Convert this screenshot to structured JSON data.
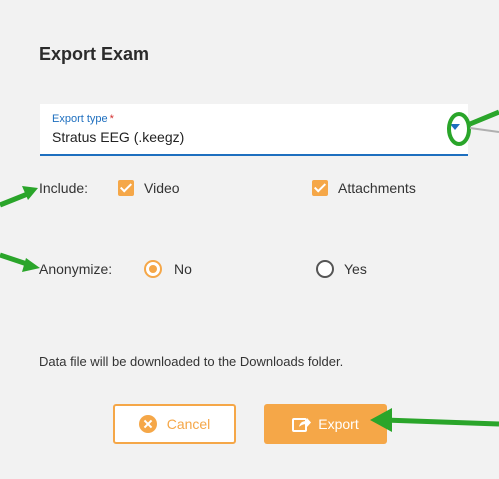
{
  "dialog": {
    "title": "Export Exam",
    "export_type": {
      "label": "Export type",
      "required_mark": "*",
      "value": "Stratus EEG (.keegz)"
    },
    "include": {
      "label": "Include:",
      "options": [
        {
          "label": "Video",
          "checked": true
        },
        {
          "label": "Attachments",
          "checked": true
        }
      ]
    },
    "anonymize": {
      "label": "Anonymize:",
      "options": [
        {
          "label": "No",
          "selected": true
        },
        {
          "label": "Yes",
          "selected": false
        }
      ]
    },
    "info_text": "Data file will be downloaded to the Downloads folder.",
    "buttons": {
      "cancel": "Cancel",
      "export": "Export"
    }
  },
  "colors": {
    "accent": "#f5a748",
    "field_underline": "#1e6fbf",
    "annotation_arrow": "#2aa52a"
  },
  "icons": {
    "cancel": "x-circle-icon",
    "export": "share-export-icon",
    "dropdown": "chevron-down-icon"
  }
}
